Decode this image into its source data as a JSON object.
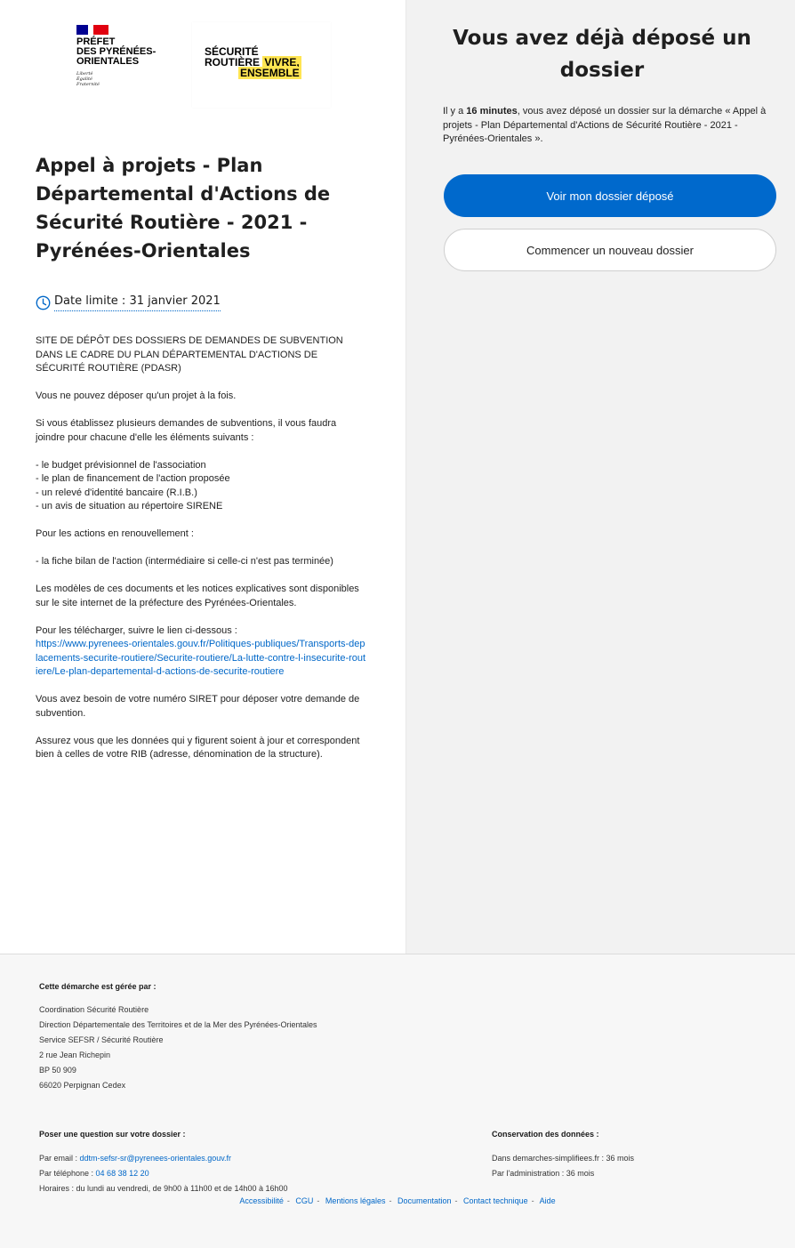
{
  "logos": {
    "prefet_lines": [
      "PRÉFET",
      "DES PYRÉNÉES-",
      "ORIENTALES"
    ],
    "devise_lines": [
      "Liberté",
      "Égalité",
      "Fraternité"
    ],
    "securite_routiere": {
      "line1": "SÉCURITÉ",
      "line2a": "ROUTIÈRE ",
      "line2b": "VIVRE,",
      "line3": "ENSEMBLE"
    }
  },
  "procedure": {
    "title": "Appel à projets - Plan Départemental d'Actions de Sécurité Routière - 2021 - Pyrénées-Orientales",
    "deadline": "Date limite : 31 janvier 2021"
  },
  "description": {
    "p1": "SITE DE DÉPÔT DES DOSSIERS DE DEMANDES DE SUBVENTION DANS LE CADRE DU PLAN DÉPARTEMENTAL D'ACTIONS DE SÉCURITÉ ROUTIÈRE (PDASR)",
    "p2": "Vous ne pouvez déposer qu'un projet à la fois.",
    "p3": "Si vous établissez plusieurs demandes de subventions, il vous faudra joindre pour chacune d'elle les éléments suivants :",
    "list": [
      "- le budget prévisionnel de l'association",
      "- le plan de financement de l'action proposée",
      "- un relevé d'identité bancaire (R.I.B.)",
      "- un avis de situation au répertoire SIRENE"
    ],
    "p4": "Pour les actions en renouvellement :",
    "p5": "- la fiche bilan de l'action (intermédiaire si celle-ci n'est pas terminée)",
    "p6": "Les modèles de ces documents et les notices explicatives sont disponibles sur le site internet de la préfecture des Pyrénées-Orientales.",
    "p7": "Pour les télécharger, suivre le lien ci-dessous :",
    "link": "https://www.pyrenees-orientales.gouv.fr/Politiques-publiques/Transports-deplacements-securite-routiere/Securite-routiere/La-lutte-contre-l-insecurite-routiere/Le-plan-departemental-d-actions-de-securite-routiere",
    "p8": "Vous avez besoin de votre numéro SIRET pour déposer votre demande de subvention.",
    "p9": "Assurez vous que les données qui y figurent soient à jour et correspondent bien à celles de votre RIB (adresse, dénomination de la structure)."
  },
  "already": {
    "title": "Vous avez déjà déposé un dossier",
    "text_prefix": "Il y a ",
    "text_bold": "16 minutes",
    "text_suffix": ", vous avez déposé un dossier sur la démarche « Appel à projets - Plan Départemental d'Actions de Sécurité Routière - 2021 - Pyrénées-Orientales ».",
    "primary_button": "Voir mon dossier déposé",
    "secondary_button": "Commencer un nouveau dossier"
  },
  "footer": {
    "managed_heading": "Cette démarche est gérée par :",
    "managed_lines": [
      "Coordination Sécurité Routière",
      "Direction Départementale des Territoires et de la Mer des Pyrénées-Orientales",
      "Service SEFSR / Sécurité Routière",
      "2 rue Jean Richepin",
      "BP 50 909",
      "66020 Perpignan Cedex"
    ],
    "question_heading": "Poser une question sur votre dossier :",
    "email_label": "Par email : ",
    "email": "ddtm-sefsr-sr@pyrenees-orientales.gouv.fr",
    "phone_label": "Par téléphone : ",
    "phone": "04 68 38 12 20",
    "hours": "Horaires : du lundi au vendredi, de 9h00 à 11h00 et de 14h00 à 16h00",
    "conservation_heading": "Conservation des données :",
    "conservation_lines": [
      "Dans demarches-simplifiees.fr : 36 mois",
      "Par l'administration : 36 mois"
    ],
    "links": [
      "Accessibilité",
      "CGU",
      "Mentions légales",
      "Documentation",
      "Contact technique",
      "Aide"
    ],
    "link_separator": "-"
  }
}
